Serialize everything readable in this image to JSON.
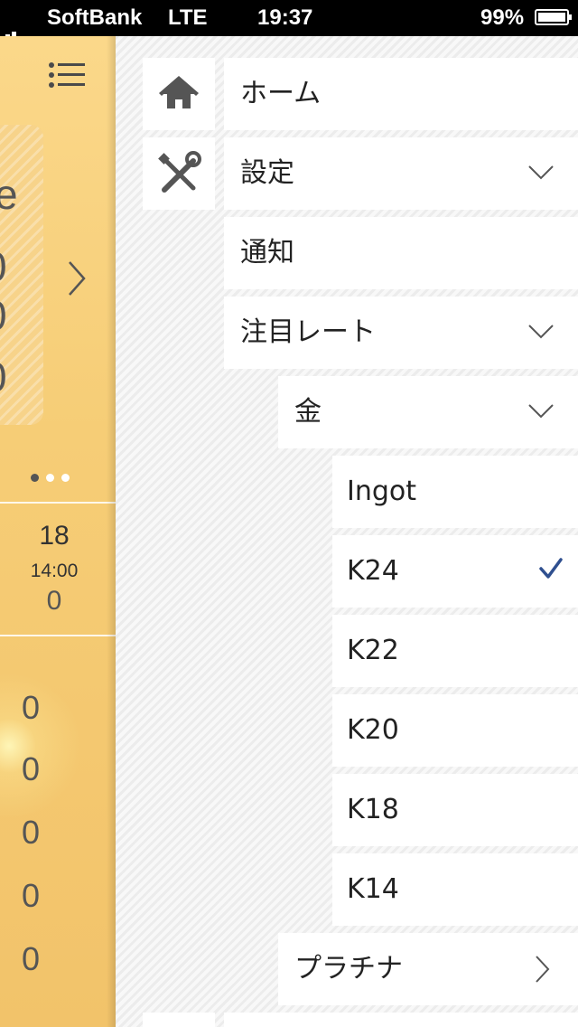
{
  "status_bar": {
    "carrier": "SoftBank",
    "network": "LTE",
    "time": "19:37",
    "battery": "99%"
  },
  "main_peek": {
    "card_glyphs": [
      "e",
      "0",
      "0",
      "0"
    ],
    "page_dots": 3,
    "active_dot": 0,
    "date": "18",
    "time": "14:00",
    "value": "0",
    "list_values": [
      "0",
      "0",
      "0",
      "0",
      "0"
    ]
  },
  "menu": {
    "home": "ホーム",
    "settings": "設定",
    "notifications": "通知",
    "watched_rates": "注目レート",
    "gold": "金",
    "gold_items": [
      {
        "label": "Ingot",
        "checked": false
      },
      {
        "label": "K24",
        "checked": true
      },
      {
        "label": "K22",
        "checked": false
      },
      {
        "label": "K20",
        "checked": false
      },
      {
        "label": "K18",
        "checked": false
      },
      {
        "label": "K14",
        "checked": false
      }
    ],
    "platinum": "プラチナ"
  },
  "icons": {
    "home": "home-icon",
    "settings": "tools-icon",
    "expand": "chevron-down-icon",
    "navigate": "chevron-right-icon",
    "selected": "checkmark-icon",
    "list_menu": "list-menu-icon"
  },
  "colors": {
    "check": "#2f4f8f",
    "peek_gold": "#f6cd76",
    "icon_gray": "#555555"
  }
}
